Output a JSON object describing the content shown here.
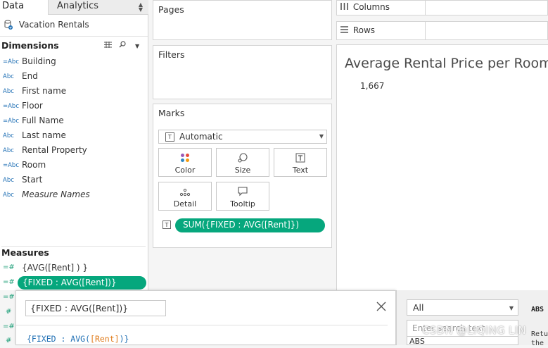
{
  "data_pane": {
    "tabs": [
      {
        "label": "Data"
      },
      {
        "label": "Analytics"
      }
    ],
    "datasource": "Vacation Rentals",
    "dimensions_header": "Dimensions",
    "dimensions": [
      {
        "type": "=Abc",
        "name": "Building"
      },
      {
        "type": "Abc",
        "name": "End"
      },
      {
        "type": "Abc",
        "name": "First name"
      },
      {
        "type": "=Abc",
        "name": "Floor"
      },
      {
        "type": "=Abc",
        "name": "Full Name"
      },
      {
        "type": "Abc",
        "name": "Last name"
      },
      {
        "type": "Abc",
        "name": "Rental Property"
      },
      {
        "type": "=Abc",
        "name": "Room"
      },
      {
        "type": "Abc",
        "name": "Start"
      },
      {
        "type": "Abc",
        "name": "Measure Names"
      }
    ],
    "measures_header": "Measures",
    "measures": [
      {
        "type": "=#",
        "name": "{AVG([Rent] ) }"
      },
      {
        "type": "=#",
        "name": "{FIXED : AVG([Rent])}"
      }
    ]
  },
  "shelves": {
    "pages": "Pages",
    "filters": "Filters",
    "marks": "Marks",
    "mark_type": "Automatic",
    "mark_buttons": [
      {
        "label": "Color"
      },
      {
        "label": "Size"
      },
      {
        "label": "Text"
      },
      {
        "label": "Detail"
      },
      {
        "label": "Tooltip"
      }
    ],
    "mark_pill": "SUM({FIXED : AVG([Rent]})",
    "columns": "Columns",
    "rows": "Rows"
  },
  "view": {
    "title": "Average Rental Price per Room",
    "value": "1,667"
  },
  "calc_editor": {
    "name": "{FIXED : AVG([Rent])}",
    "formula_open": "{FIXED : AVG(",
    "formula_field": "[Rent]",
    "formula_close": ")}"
  },
  "functions_panel": {
    "category": "All",
    "search_placeholder": "Enter search text",
    "first_item": "ABS",
    "desc_head": "ABS",
    "desc_text": "Retu\nthe"
  },
  "watermark": "CSDN @LIQING LIN",
  "colors": {
    "accent_green": "#06a77d",
    "type_blue": "#1f6fb4",
    "formula_field": "#e07b1a"
  }
}
